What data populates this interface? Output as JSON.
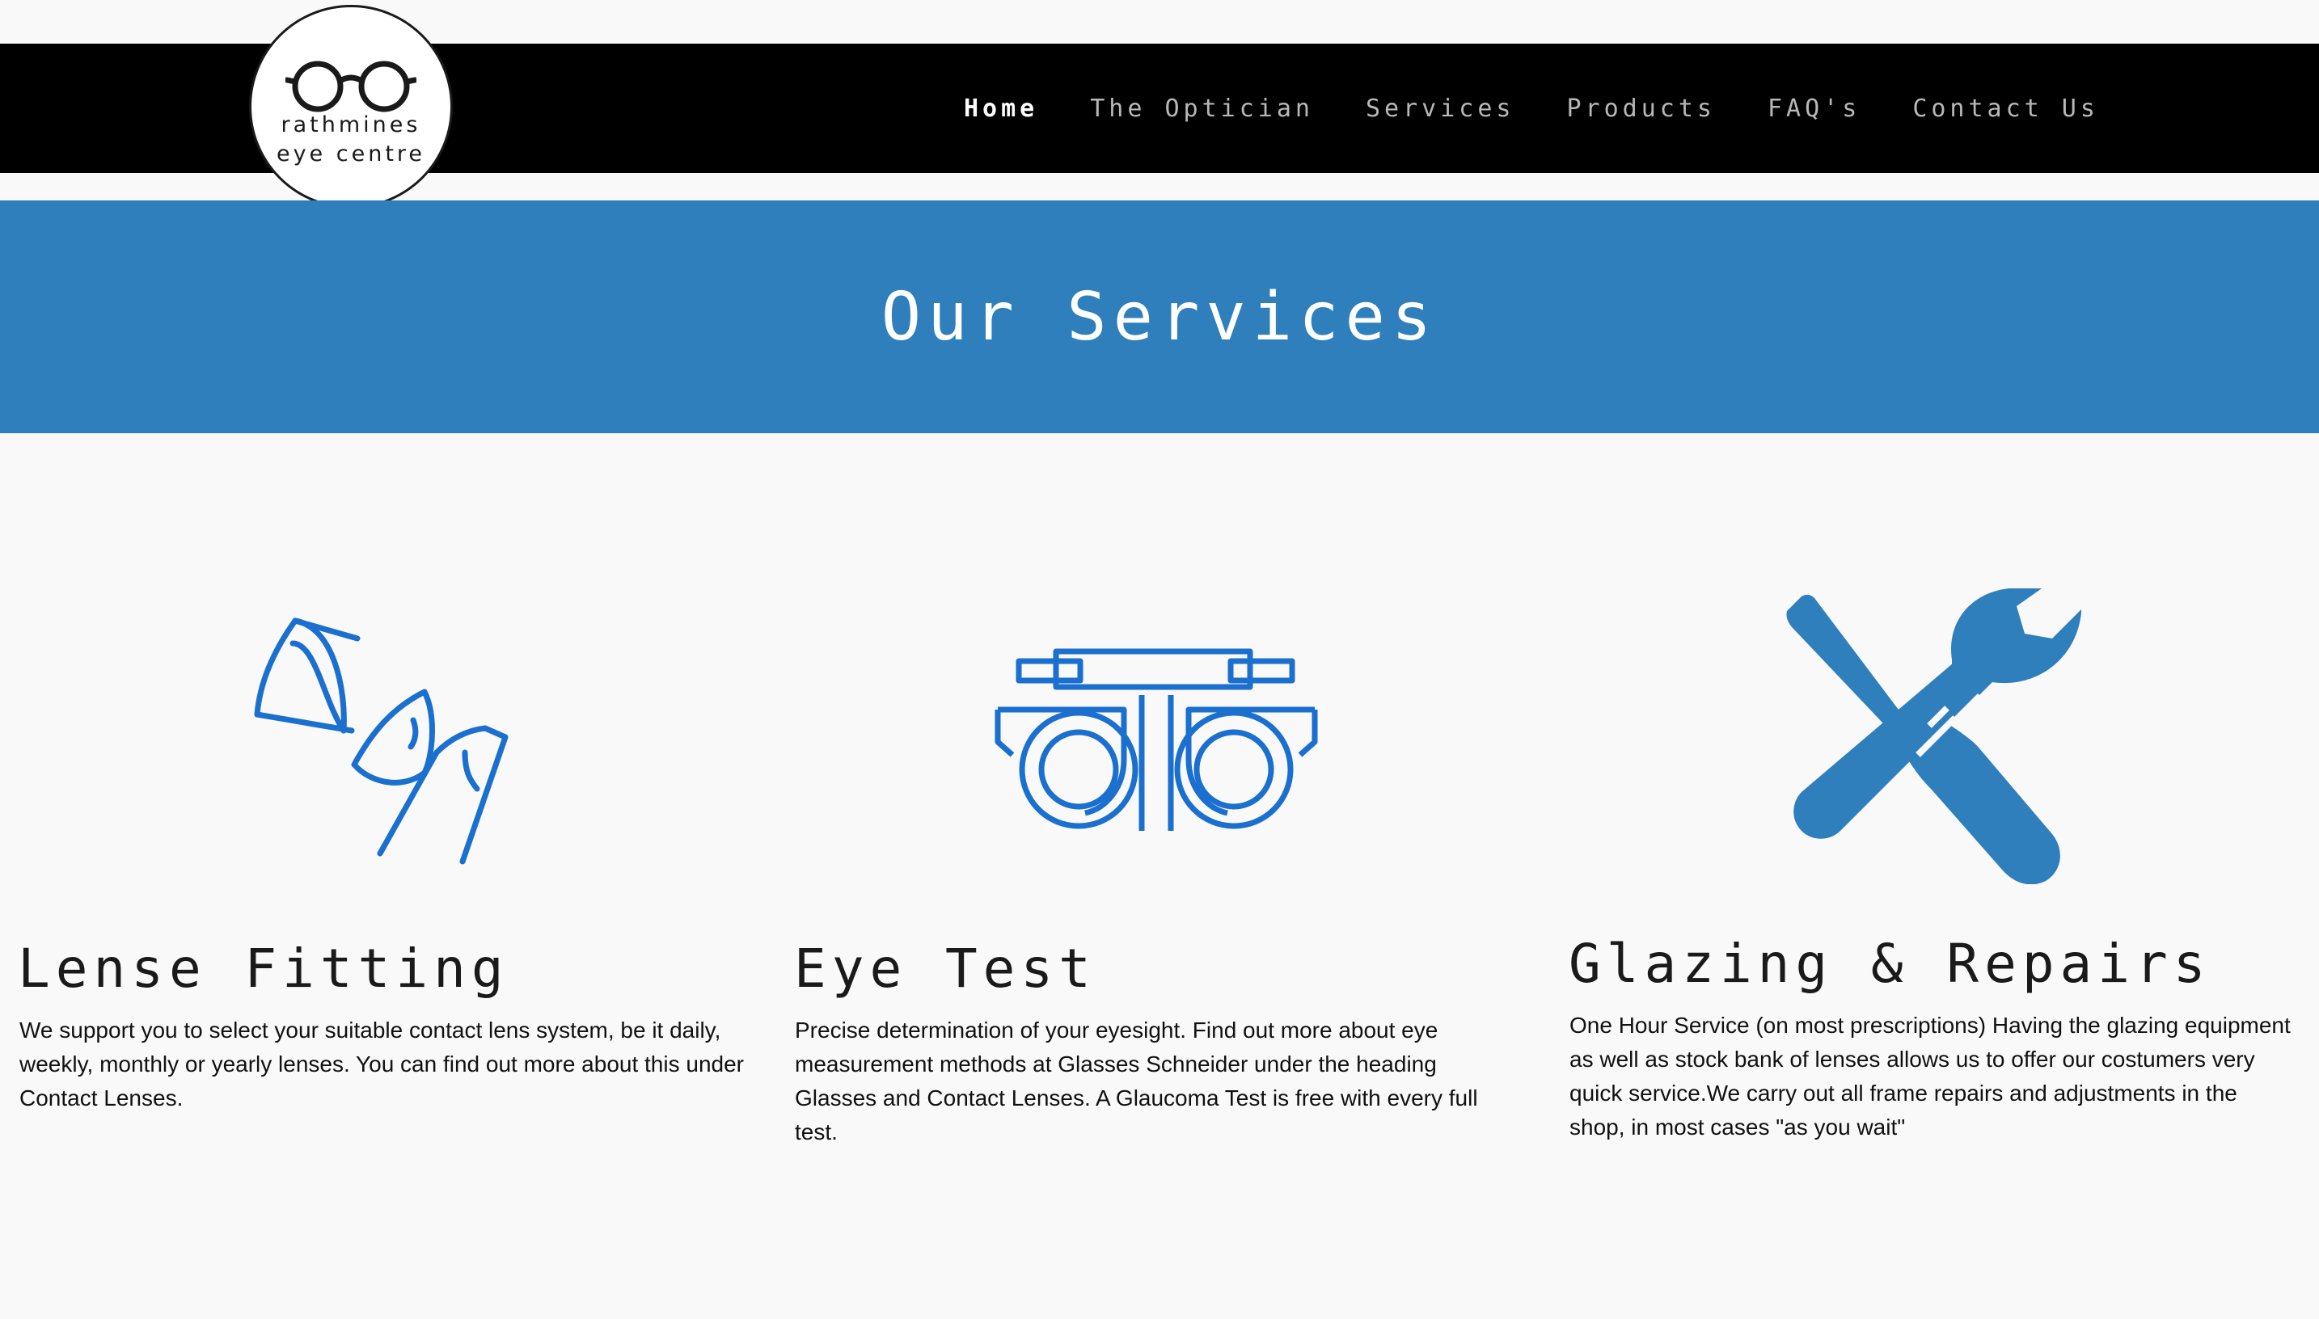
{
  "logo": {
    "line1": "rathmines",
    "line2": "eye centre"
  },
  "nav": {
    "items": [
      {
        "label": "Home",
        "active": true
      },
      {
        "label": "The Optician",
        "active": false
      },
      {
        "label": "Services",
        "active": false
      },
      {
        "label": "Products",
        "active": false
      },
      {
        "label": "FAQ's",
        "active": false
      },
      {
        "label": "Contact Us",
        "active": false
      }
    ]
  },
  "hero": {
    "title": "Our Services"
  },
  "services": [
    {
      "title": "Lense Fitting",
      "description": "We support you to select your suitable contact lens system, be it daily, weekly, monthly or yearly lenses. You can find out more about this under Contact Lenses.",
      "icon": "contact-lens-icon"
    },
    {
      "title": "Eye Test",
      "description": "Precise determination of your eyesight. Find out more about eye measurement methods at Glasses Schneider under the heading Glasses and Contact Lenses. A Glaucoma Test is free with every full test.",
      "icon": "trial-frame-icon"
    },
    {
      "title": "Glazing & Repairs",
      "description": "One Hour Service (on most prescriptions) Having the glazing equipment as well as stock bank of lenses allows us to offer our costumers very quick service.We carry out all frame repairs and adjustments in the shop, in most cases \"as you wait\"",
      "icon": "tools-icon"
    }
  ],
  "colors": {
    "nav_background": "#000000",
    "hero_background": "#2f7fbd",
    "icon_blue": "#1a6fcf",
    "page_background": "#f9f9f9"
  }
}
